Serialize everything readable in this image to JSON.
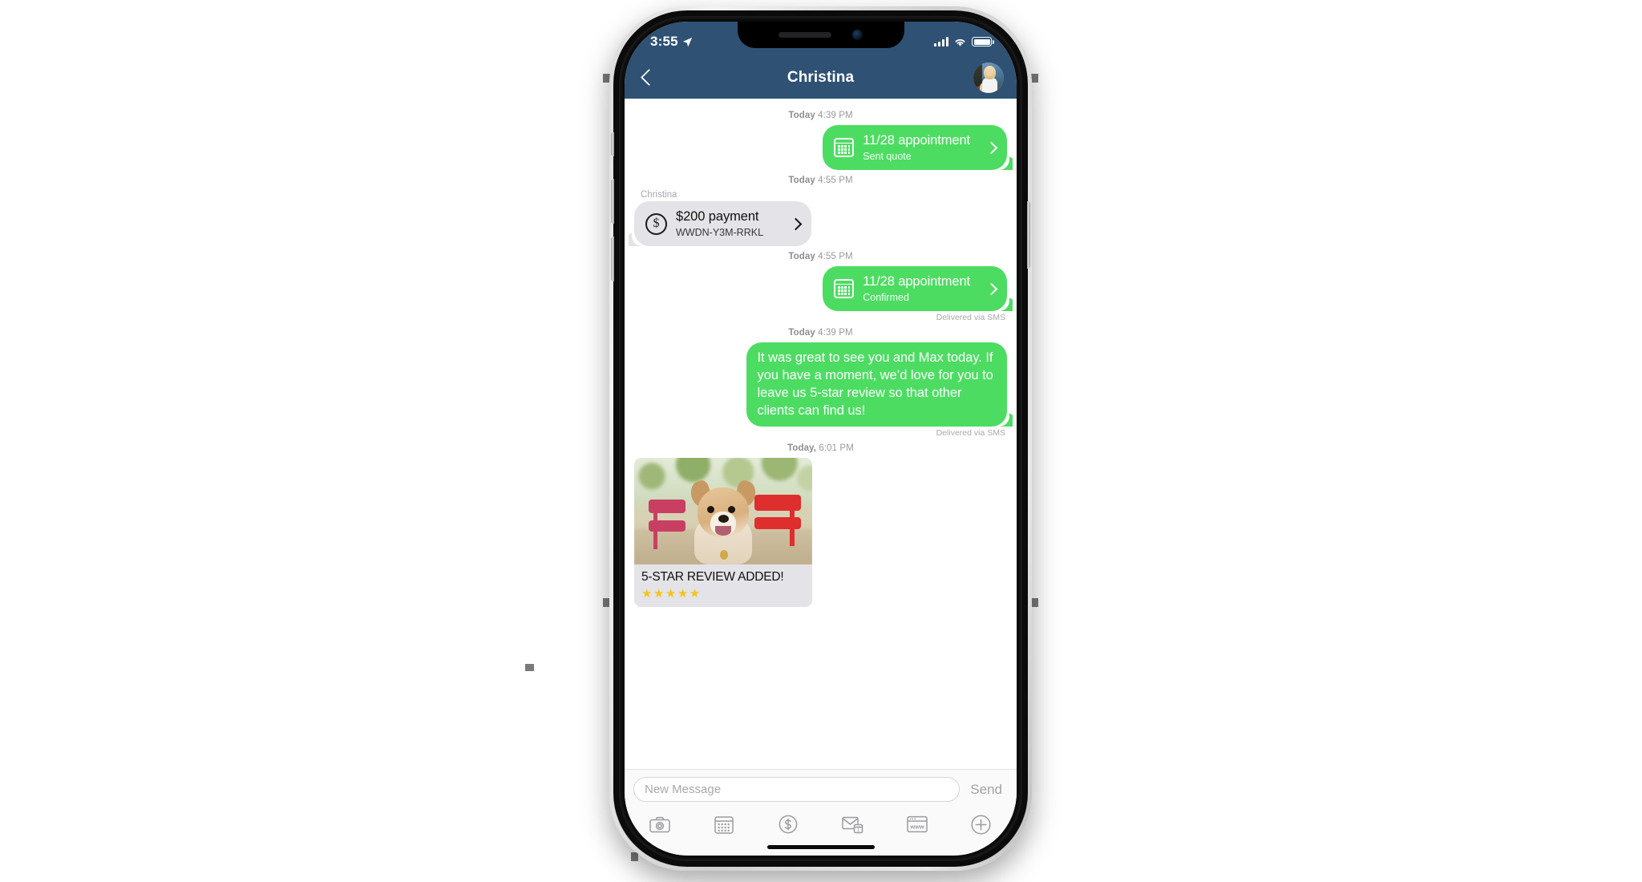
{
  "device": {
    "type": "smartphone"
  },
  "status_bar": {
    "time": "3:55",
    "location_icon": "location-arrow-icon",
    "signal_icon": "cellular-signal-icon",
    "wifi_icon": "wifi-icon",
    "battery_icon": "battery-icon"
  },
  "nav": {
    "back_icon": "back-chevron-icon",
    "title": "Christina",
    "avatar_name": "contact-avatar"
  },
  "theme": {
    "header_navy": "#2e5174",
    "outgoing_green": "#4ddc62",
    "incoming_grey": "#e3e3e8",
    "star_gold": "#f5c518",
    "timestamp_grey": "#9a9a9e"
  },
  "thread": [
    {
      "id": "ts-1",
      "kind": "timestamp",
      "day": "Today",
      "time": "4:39 PM"
    },
    {
      "id": "msg-1",
      "kind": "appointment",
      "direction": "outgoing",
      "icon": "calendar-icon",
      "title": "11/28 appointment",
      "subtitle": "Sent quote",
      "chevron": "chevron-right-icon"
    },
    {
      "id": "ts-2",
      "kind": "timestamp",
      "day": "Today",
      "time": "4:55 PM"
    },
    {
      "id": "msg-2",
      "kind": "payment",
      "direction": "incoming",
      "sender": "Christina",
      "icon": "dollar-circle-icon",
      "title": "$200 payment",
      "subtitle": "WWDN-Y3M-RRKL",
      "chevron": "chevron-right-icon"
    },
    {
      "id": "ts-3",
      "kind": "timestamp",
      "day": "Today",
      "time": "4:55 PM"
    },
    {
      "id": "msg-3",
      "kind": "appointment",
      "direction": "outgoing",
      "icon": "calendar-icon",
      "title": "11/28 appointment",
      "subtitle": "Confirmed",
      "chevron": "chevron-right-icon",
      "delivery": "Delivered via SMS"
    },
    {
      "id": "ts-4",
      "kind": "timestamp",
      "day": "Today",
      "time": "4:39 PM"
    },
    {
      "id": "msg-4",
      "kind": "text",
      "direction": "outgoing",
      "body": "It was great to see you and Max today. If you have a moment, we’d love for you to leave us 5-star review so that other clients can find us!",
      "delivery": "Delivered via SMS"
    },
    {
      "id": "ts-5",
      "kind": "timestamp",
      "day": "Today,",
      "time": "6:01 PM"
    },
    {
      "id": "msg-5",
      "kind": "photo_card",
      "direction": "incoming",
      "photo_alt": "puppy-photo",
      "caption": "5-STAR REVIEW ADDED!",
      "stars": "★★★★★",
      "star_count": 5
    }
  ],
  "composer": {
    "input_value": "",
    "input_placeholder": "New Message",
    "send_label": "Send"
  },
  "toolbar": [
    {
      "id": "camera",
      "icon": "camera-icon"
    },
    {
      "id": "calendar",
      "icon": "calendar-icon"
    },
    {
      "id": "payment",
      "icon": "dollar-circle-icon"
    },
    {
      "id": "invoice",
      "icon": "envelope-calendar-icon"
    },
    {
      "id": "website",
      "icon": "www-browser-icon"
    },
    {
      "id": "more",
      "icon": "plus-circle-icon"
    }
  ]
}
